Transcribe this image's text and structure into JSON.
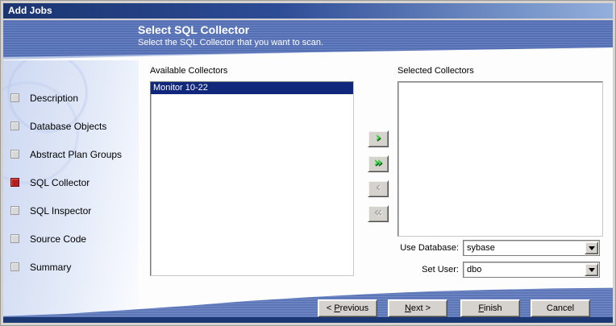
{
  "window": {
    "title": "Add Jobs"
  },
  "header": {
    "title": "Select SQL Collector",
    "subtitle": "Select the SQL Collector that you want to scan."
  },
  "sidebar": {
    "items": [
      {
        "label": "Description",
        "active": false
      },
      {
        "label": "Database Objects",
        "active": false
      },
      {
        "label": "Abstract Plan Groups",
        "active": false
      },
      {
        "label": "SQL Collector",
        "active": true
      },
      {
        "label": "SQL Inspector",
        "active": false
      },
      {
        "label": "Source Code",
        "active": false
      },
      {
        "label": "Summary",
        "active": false
      }
    ]
  },
  "main": {
    "available": {
      "label": "Available Collectors",
      "items": [
        {
          "text": "Monitor 10-22",
          "selected": true
        }
      ]
    },
    "selected": {
      "label": "Selected Collectors",
      "items": []
    },
    "transfer_buttons": [
      {
        "name": "move-right-button",
        "icon": "chevron-right-icon",
        "glyph": "›",
        "enabled": true
      },
      {
        "name": "move-all-right-button",
        "icon": "double-chevron-right-icon",
        "glyph": "»",
        "enabled": true
      },
      {
        "name": "move-left-button",
        "icon": "chevron-left-icon",
        "glyph": "‹",
        "enabled": false
      },
      {
        "name": "move-all-left-button",
        "icon": "double-chevron-left-icon",
        "glyph": "«",
        "enabled": false
      }
    ],
    "use_database": {
      "label": "Use Database:",
      "value": "sybase"
    },
    "set_user": {
      "label": "Set User:",
      "value": "dbo"
    }
  },
  "footer": {
    "previous": {
      "pre": "< ",
      "u": "P",
      "post": "revious"
    },
    "next": {
      "pre": "",
      "u": "N",
      "post": "ext >"
    },
    "finish": {
      "pre": "",
      "u": "F",
      "post": "inish"
    },
    "cancel": {
      "label": "Cancel"
    }
  },
  "colors": {
    "titlebar_start": "#1b3570",
    "titlebar_end": "#93afdc",
    "band": "#5570b2",
    "band_stripe": "#6a81c4",
    "wedge": "#b9c7e7",
    "wave": "#5d76b6",
    "wave_stripe": "#7189c8",
    "navy_strip": "#1c3874",
    "selection_bg": "#10277c",
    "active_step": "#b51f1f",
    "button_face": "#d6d3ce",
    "arrow_green": "#2fd136",
    "arrow_disabled": "#a8a8a8"
  }
}
